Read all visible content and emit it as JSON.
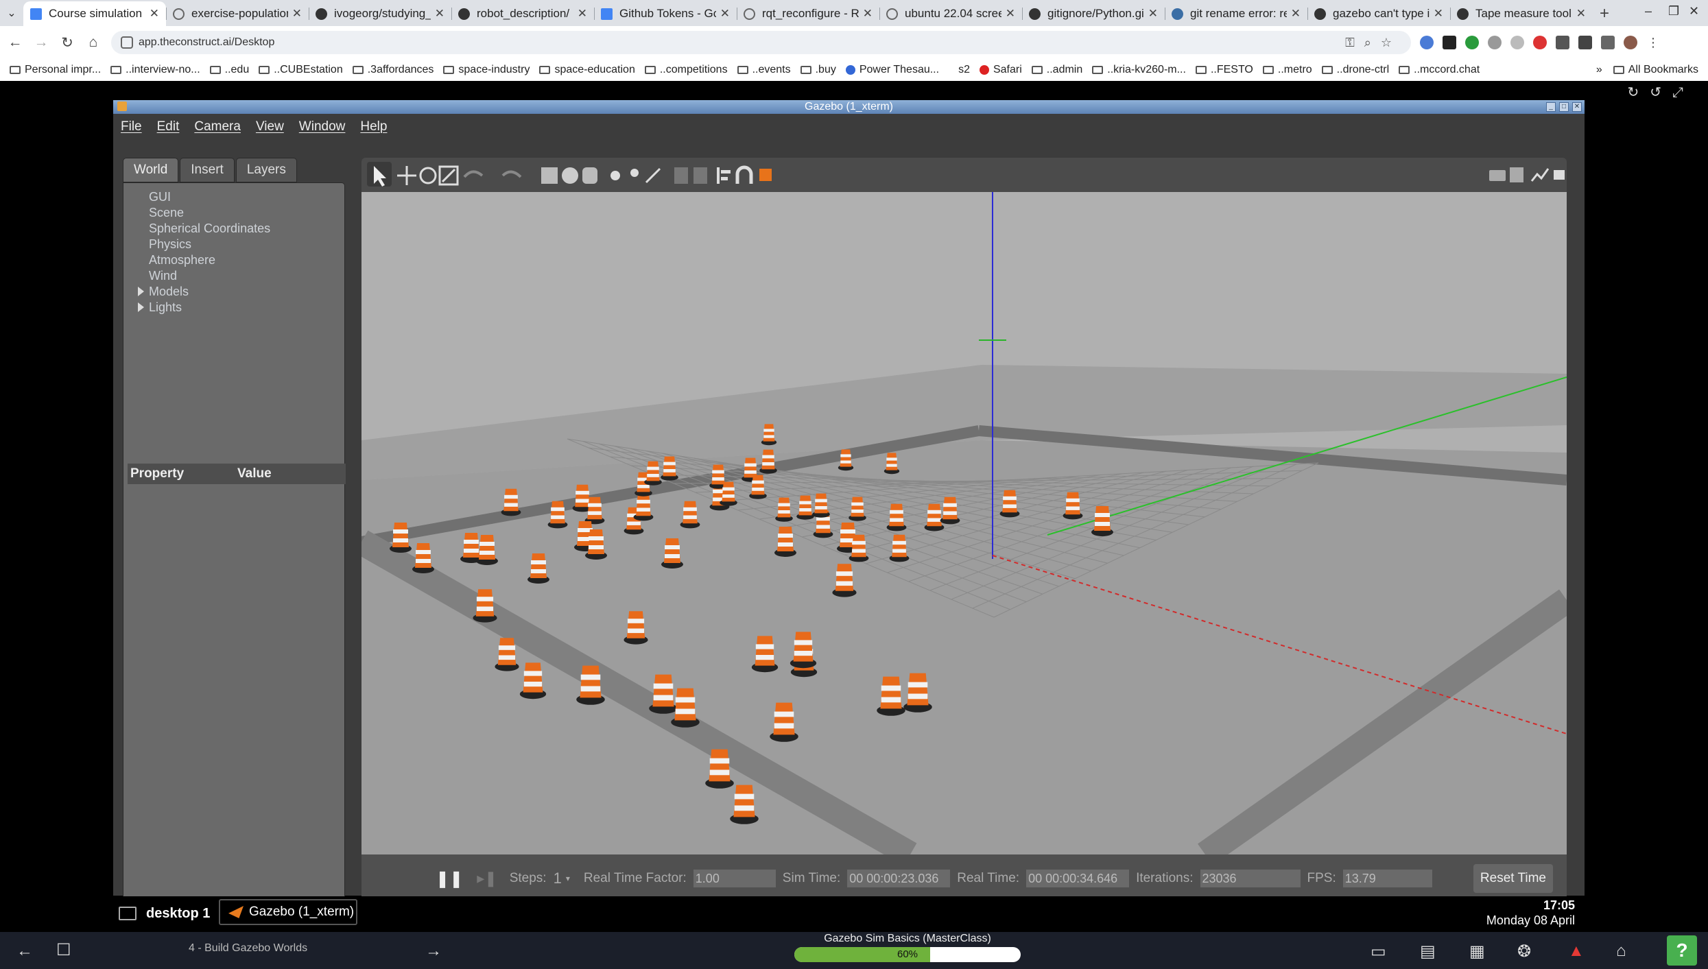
{
  "browser": {
    "tabs": [
      {
        "title": "Course simulation -",
        "active": true
      },
      {
        "title": "exercise-population"
      },
      {
        "title": "ivogeorg/studying_"
      },
      {
        "title": "robot_description/"
      },
      {
        "title": "Github Tokens - Goo"
      },
      {
        "title": "rqt_reconfigure - RO"
      },
      {
        "title": "ubuntu 22.04 screen"
      },
      {
        "title": "gitignore/Python.gi"
      },
      {
        "title": "git rename error: re"
      },
      {
        "title": "gazebo can't type in"
      },
      {
        "title": "Tape measure tool"
      }
    ],
    "url": "app.theconstruct.ai/Desktop",
    "bookmarks": [
      "Personal impr...",
      "..interview-no...",
      "..edu",
      "..CUBEstation",
      ".3affordances",
      "space-industry",
      "space-education",
      "..competitions",
      "..events",
      ".buy",
      "Power Thesau...",
      "s2",
      "Safari",
      "..admin",
      "..kria-kv260-m...",
      "..FESTO",
      "..metro",
      "..drone-ctrl",
      "..mccord.chat"
    ],
    "all_bookmarks": "All Bookmarks"
  },
  "gazebo": {
    "window_title": "Gazebo (1_xterm)",
    "menus": [
      "File",
      "Edit",
      "Camera",
      "View",
      "Window",
      "Help"
    ],
    "panel_tabs": [
      "World",
      "Insert",
      "Layers"
    ],
    "world_tree": [
      "GUI",
      "Scene",
      "Spherical Coordinates",
      "Physics",
      "Atmosphere",
      "Wind"
    ],
    "world_tree_expandable": [
      "Models",
      "Lights"
    ],
    "property_header": {
      "property": "Property",
      "value": "Value"
    },
    "bottom": {
      "steps_label": "Steps:",
      "steps_value": "1",
      "rtf_label": "Real Time Factor:",
      "rtf_value": "1.00",
      "sim_time_label": "Sim Time:",
      "sim_time_value": "00 00:00:23.036",
      "real_time_label": "Real Time:",
      "real_time_value": "00 00:00:34.646",
      "iterations_label": "Iterations:",
      "iterations_value": "23036",
      "fps_label": "FPS:",
      "fps_value": "13.79",
      "reset_label": "Reset Time"
    }
  },
  "taskbar": {
    "desktop_label": "desktop 1",
    "app_label": "Gazebo (1_xterm)",
    "time": "17:05",
    "date": "Monday 08 April"
  },
  "course": {
    "lesson": "4 - Build Gazebo Worlds",
    "course_name": "Gazebo Sim Basics (MasterClass)",
    "progress_label": "60%",
    "progress": 0.6,
    "help": "?"
  },
  "colors": {
    "progress_green": "#6fb23c",
    "cone_orange": "#e86a1a",
    "help_green": "#48b04f"
  }
}
